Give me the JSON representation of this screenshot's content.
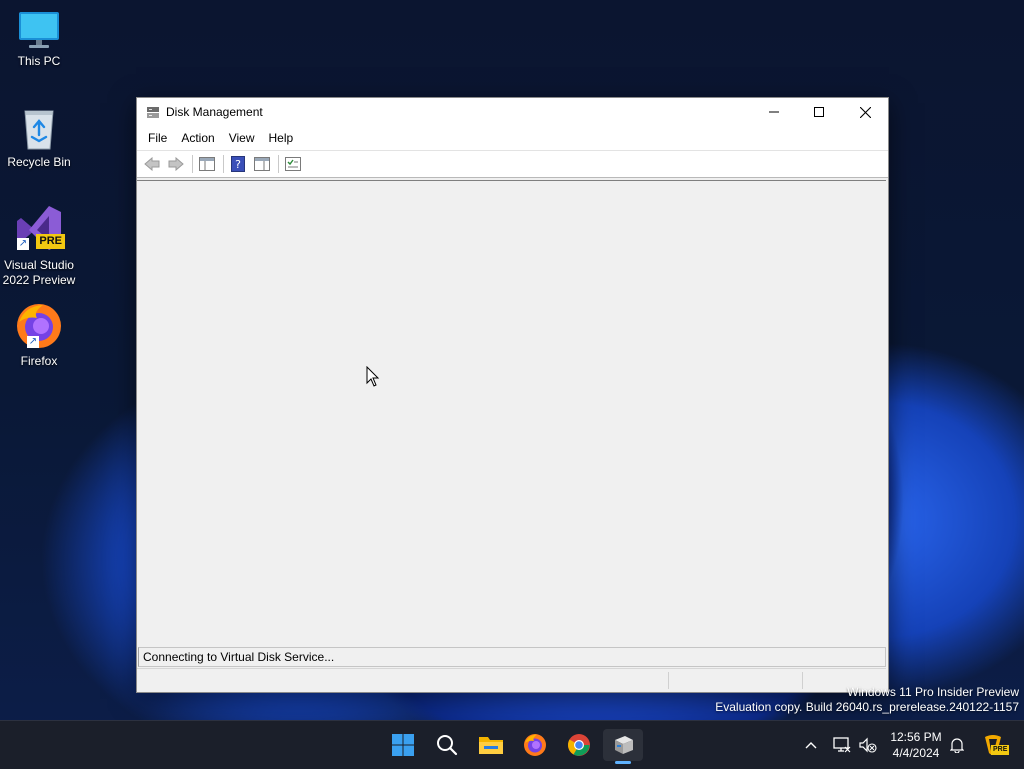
{
  "desktop": {
    "icons": [
      {
        "label": "This PC"
      },
      {
        "label": "Recycle Bin"
      },
      {
        "label_line1": "Visual Studio",
        "label_line2": "2022 Preview",
        "badge": "PRE"
      },
      {
        "label": "Firefox"
      }
    ]
  },
  "window": {
    "title": "Disk Management",
    "menu": [
      "File",
      "Action",
      "View",
      "Help"
    ],
    "toolbar_icons": [
      "back-icon",
      "forward-icon",
      "show-hide-console-tree-icon",
      "help-icon",
      "show-hide-action-pane-icon",
      "properties-icon"
    ],
    "status_message": "Connecting to Virtual Disk Service..."
  },
  "watermark": {
    "line1": "Windows 11 Pro Insider Preview",
    "line2": "Evaluation copy. Build 26040.rs_prerelease.240122-1157"
  },
  "taskbar": {
    "apps": [
      "start-icon",
      "search-icon",
      "file-explorer-icon",
      "firefox-icon",
      "chrome-icon",
      "disk-management-icon"
    ],
    "tray_badge": "PRE"
  },
  "clock": {
    "time": "12:56 PM",
    "date": "4/4/2024"
  },
  "colors": {
    "accent": "#5fb2ff",
    "taskbar_bg": "#1b1f2a",
    "window_bg": "#f0f0f0"
  }
}
